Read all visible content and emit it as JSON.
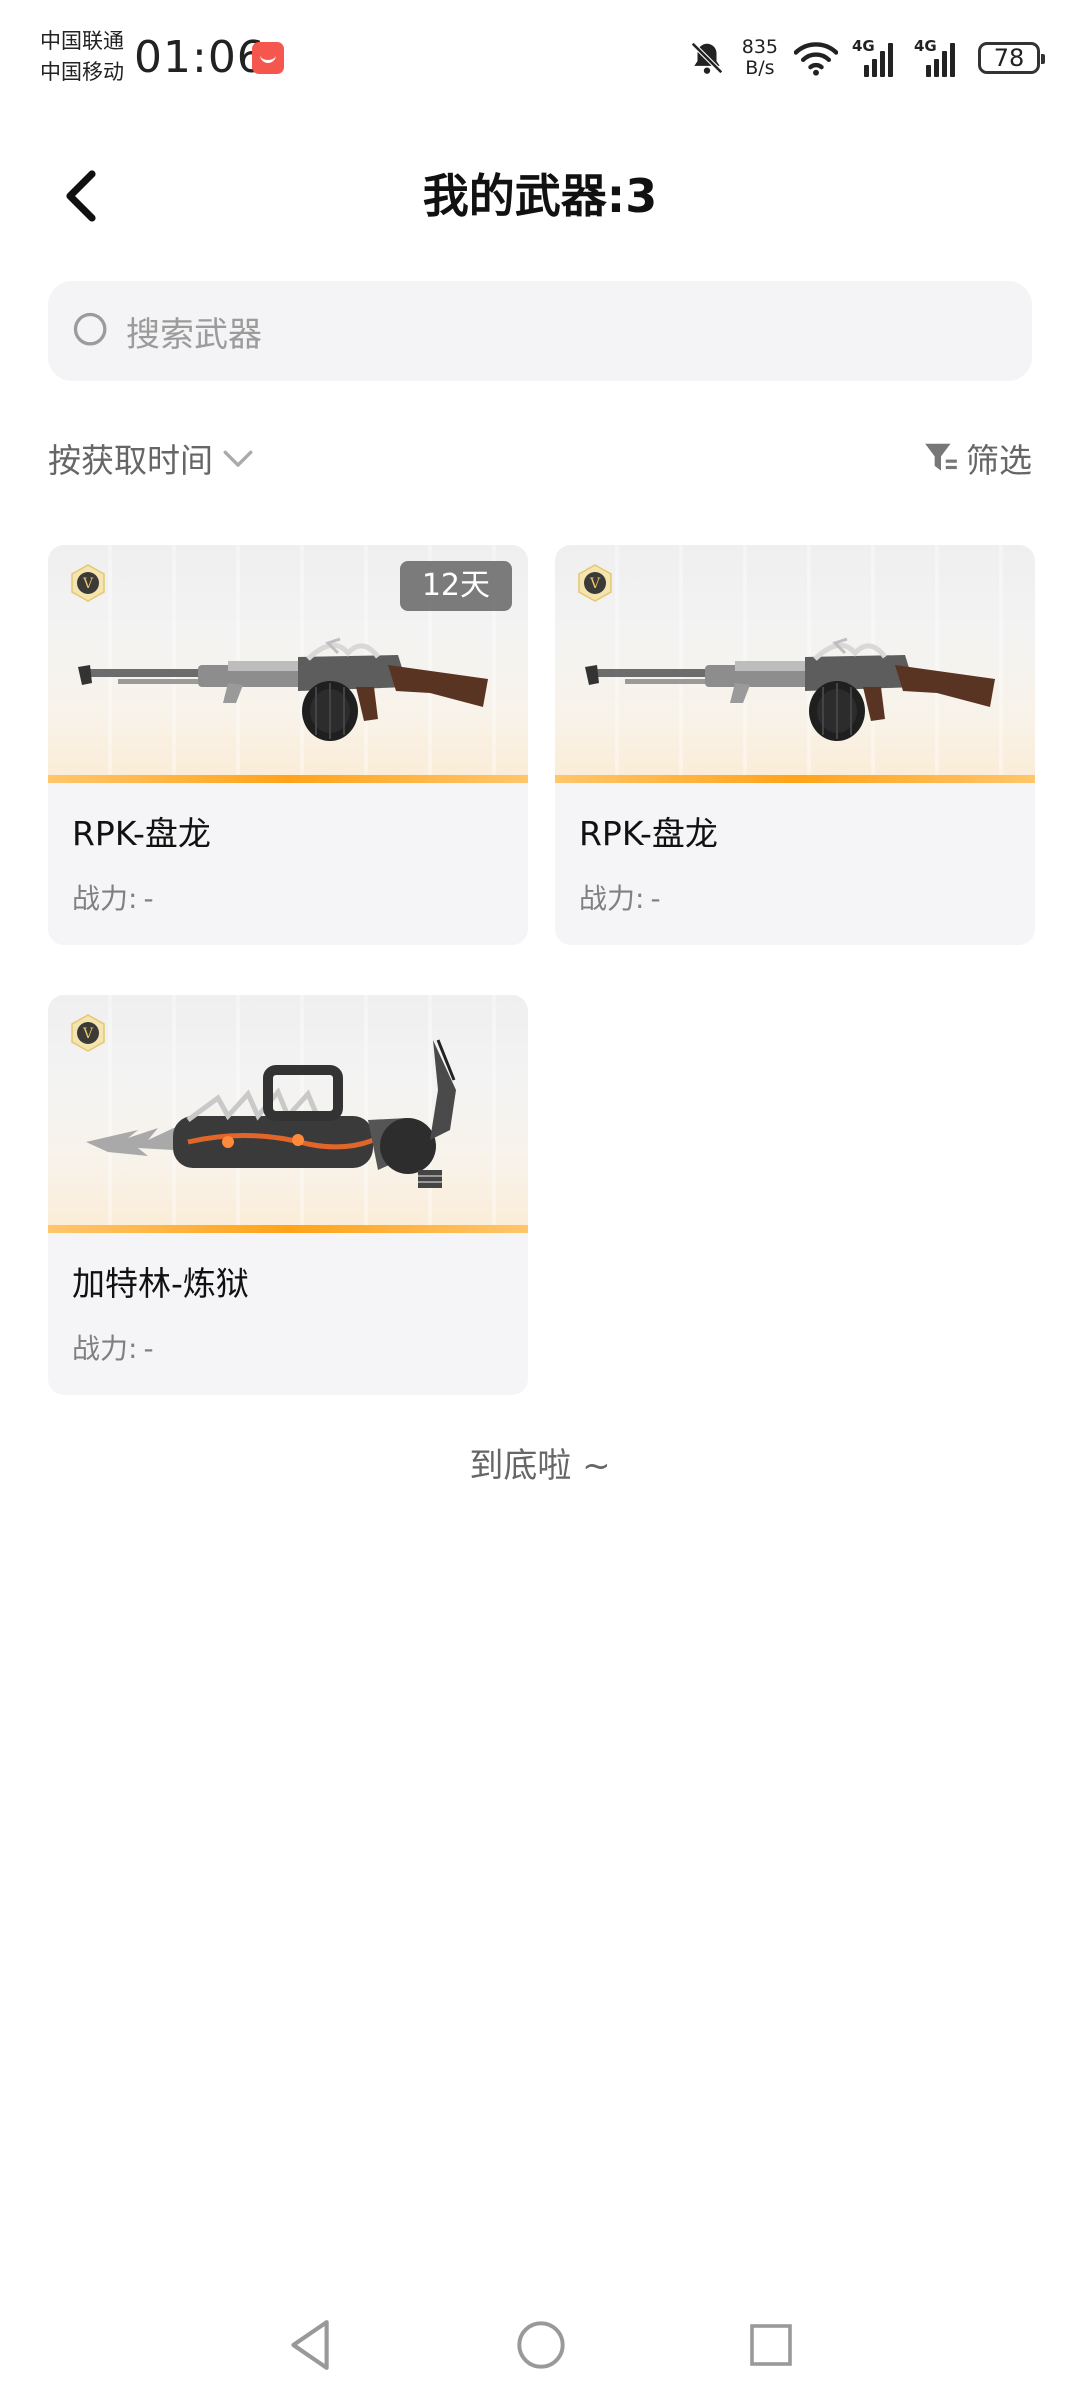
{
  "status_bar": {
    "carrier_1": "中国联通",
    "carrier_2": "中国移动",
    "time": "01:06",
    "net_speed_value": "835",
    "net_speed_unit": "B/s",
    "signal_1": "4G",
    "signal_2": "4G",
    "battery": "78",
    "icons": [
      "app-notification-icon",
      "mute-bell-icon",
      "wifi-icon",
      "cellular-signal-icon",
      "battery-icon"
    ]
  },
  "header": {
    "back_icon": "chevron-left-icon",
    "title": "我的武器:3"
  },
  "search": {
    "placeholder": "搜索武器",
    "icon": "search-icon"
  },
  "sort": {
    "label": "按获取时间",
    "icon": "chevron-down-icon"
  },
  "filter": {
    "label": "筛选",
    "icon": "filter-icon"
  },
  "weapons": [
    {
      "name": "RPK-盘龙",
      "power_label": "战力:",
      "power_value": "-",
      "days_left": "12天",
      "badge": "V"
    },
    {
      "name": "RPK-盘龙",
      "power_label": "战力:",
      "power_value": "-",
      "badge": "V"
    },
    {
      "name": "加特林-炼狱",
      "power_label": "战力:",
      "power_value": "-",
      "badge": "V"
    }
  ],
  "list_end": "到底啦 ~",
  "nav_bar": {
    "back": "triangle-back-icon",
    "home": "circle-home-icon",
    "recents": "square-recents-icon"
  },
  "colors": {
    "accent_orange": "#ffa319",
    "card_bg": "#f5f5f7",
    "search_bg": "#f4f4f6",
    "muted_text": "#808080"
  }
}
